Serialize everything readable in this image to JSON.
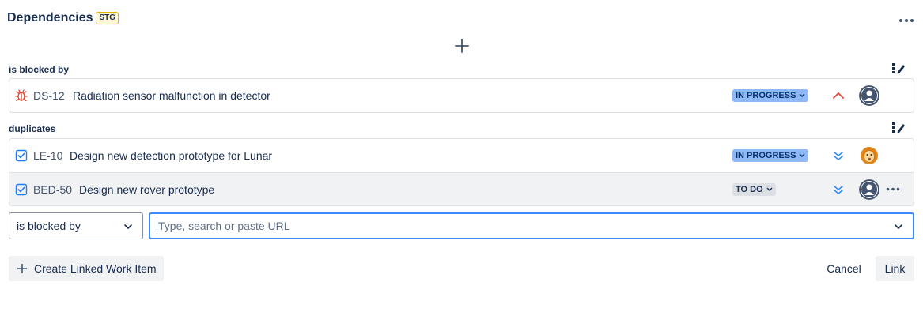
{
  "header": {
    "title": "Dependencies",
    "env_badge": "STG",
    "more_icon": "more-horizontal-icon"
  },
  "add_icon": "plus-icon",
  "sections": [
    {
      "label": "is blocked by",
      "edit_icon": "edit-list-icon",
      "items": [
        {
          "type_icon": "bug-icon",
          "key": "DS-12",
          "summary": "Radiation sensor malfunction in detector",
          "status": "IN PROGRESS",
          "priority_icon": "priority-high-icon",
          "avatar": "default-avatar"
        }
      ]
    },
    {
      "label": "duplicates",
      "edit_icon": "edit-list-icon",
      "items": [
        {
          "type_icon": "task-icon",
          "key": "LE-10",
          "summary": "Design new detection prototype for Lunar",
          "status": "IN PROGRESS",
          "priority_icon": "priority-lowest-icon",
          "avatar": "lion-avatar"
        },
        {
          "type_icon": "task-icon",
          "key": "BED-50",
          "summary": "Design new rover prototype",
          "status": "TO DO",
          "priority_icon": "priority-lowest-icon",
          "avatar": "default-avatar"
        }
      ]
    }
  ],
  "link_form": {
    "relation_value": "is blocked by",
    "search_placeholder": "Type, search or paste URL",
    "search_value": ""
  },
  "actions": {
    "create_label": "Create Linked Work Item",
    "cancel_label": "Cancel",
    "link_label": "Link"
  },
  "colors": {
    "accent": "#388bff",
    "in_progress_bg": "#8fb8f6",
    "todo_bg": "#dcdfe4",
    "bug_red": "#e34935",
    "priority_high": "#e34935",
    "priority_low": "#388bff"
  }
}
